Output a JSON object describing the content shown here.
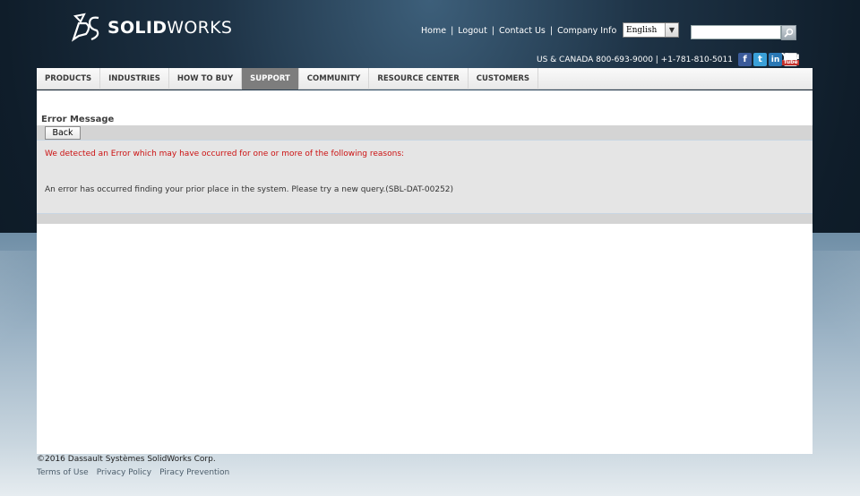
{
  "header": {
    "logo_bold": "SOLID",
    "logo_light": "WORKS",
    "links": [
      "Home",
      "Logout",
      "Contact Us",
      "Company Info"
    ],
    "language": "English",
    "search_placeholder": "",
    "phone": "US & CANADA 800-693-9000 | +1-781-810-5011",
    "social": [
      {
        "name": "facebook-icon",
        "glyph": "f"
      },
      {
        "name": "twitter-icon",
        "glyph": "t"
      },
      {
        "name": "linkedin-icon",
        "glyph": "in"
      },
      {
        "name": "youtube-icon",
        "glyph": "You"
      }
    ]
  },
  "nav": {
    "items": [
      "PRODUCTS",
      "INDUSTRIES",
      "HOW TO BUY",
      "SUPPORT",
      "COMMUNITY",
      "RESOURCE CENTER",
      "CUSTOMERS"
    ],
    "active": "SUPPORT"
  },
  "main": {
    "title": "Error Message",
    "back_label": "Back",
    "error_intro": "We detected an Error which may have occurred for one or more of the following reasons:",
    "error_detail": "An error has occurred finding your prior place in the system. Please try a new query.(SBL-DAT-00252)"
  },
  "footer": {
    "copyright": "©2016 Dassault Systèmes SolidWorks Corp.",
    "links": [
      "Terms of Use",
      "Privacy Policy",
      "Piracy Prevention"
    ]
  },
  "colors": {
    "error_red": "#cc1111",
    "nav_active": "#7d7d7d",
    "panel_gray": "#e5e5e5"
  }
}
